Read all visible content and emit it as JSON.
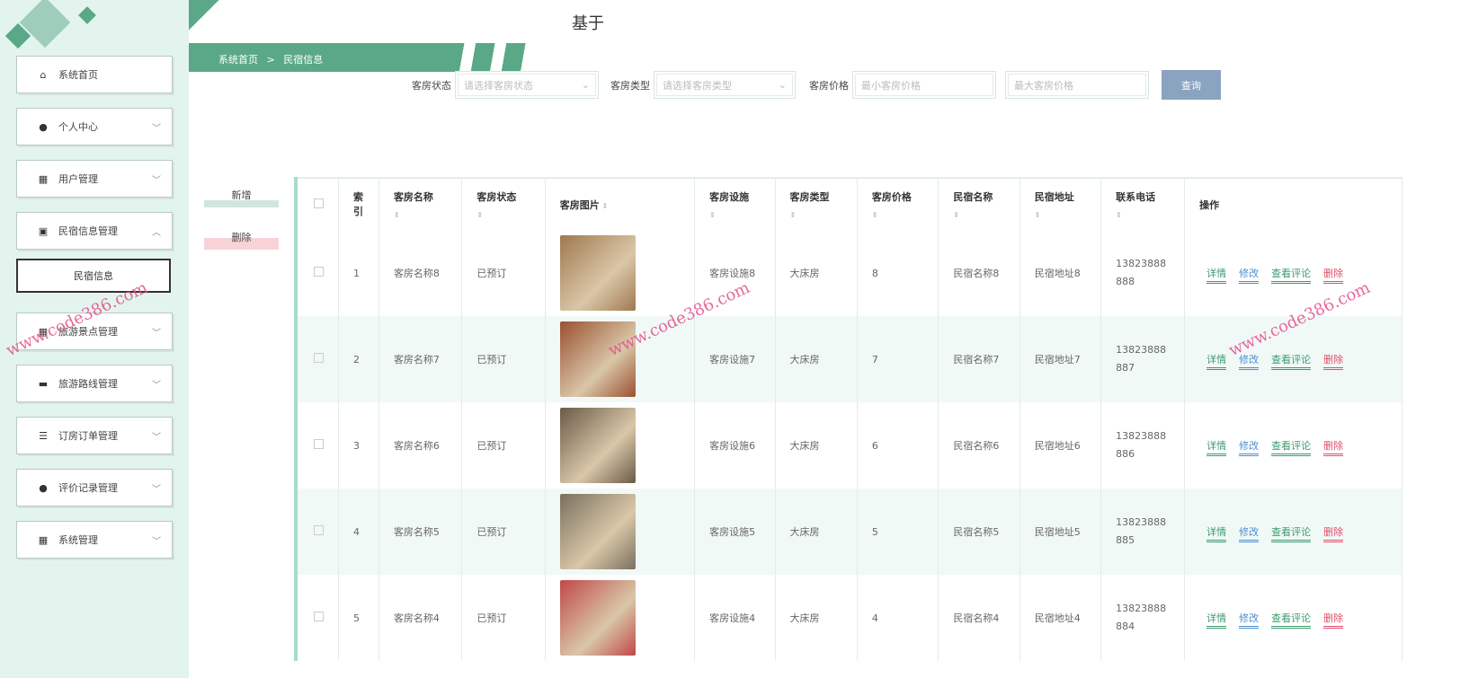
{
  "header": {
    "title": "基于",
    "breadcrumb": [
      "系统首页",
      ">",
      "民宿信息"
    ]
  },
  "sidebar": {
    "items": [
      {
        "label": "系统首页",
        "icon": "home-icon",
        "glyph": "⌂"
      },
      {
        "label": "个人中心",
        "icon": "user-icon",
        "glyph": "●"
      },
      {
        "label": "用户管理",
        "icon": "grid-icon",
        "glyph": "▦"
      },
      {
        "label": "民宿信息管理",
        "icon": "clipboard-icon",
        "glyph": "▣"
      },
      {
        "label": "旅游景点管理",
        "icon": "grid-icon",
        "glyph": "▦"
      },
      {
        "label": "旅游路线管理",
        "icon": "briefcase-icon",
        "glyph": "▬"
      },
      {
        "label": "订房订单管理",
        "icon": "list-icon",
        "glyph": "☰"
      },
      {
        "label": "评价记录管理",
        "icon": "user-icon",
        "glyph": "●"
      },
      {
        "label": "系统管理",
        "icon": "grid-icon",
        "glyph": "▦"
      }
    ],
    "submenu": "民宿信息"
  },
  "search": {
    "status_label": "客房状态",
    "status_placeholder": "请选择客房状态",
    "type_label": "客房类型",
    "type_placeholder": "请选择客房类型",
    "price_label": "客房价格",
    "min_placeholder": "最小客房价格",
    "max_placeholder": "最大客房价格",
    "query": "查询"
  },
  "actions": {
    "add": "新增",
    "delete": "删除"
  },
  "table": {
    "headers": [
      "索引",
      "客房名称",
      "客房状态",
      "客房图片",
      "客房设施",
      "客房类型",
      "客房价格",
      "民宿名称",
      "民宿地址",
      "联系电话",
      "操作"
    ],
    "ops": [
      "详情",
      "修改",
      "查看评论",
      "删除"
    ],
    "rows": [
      {
        "index": "1",
        "name": "客房名称8",
        "status": "已预订",
        "facility": "客房设施8",
        "type": "大床房",
        "price": "8",
        "mname": "民宿名称8",
        "addr": "民宿地址8",
        "phone": "13823888888",
        "img": "#a07850"
      },
      {
        "index": "2",
        "name": "客房名称7",
        "status": "已预订",
        "facility": "客房设施7",
        "type": "大床房",
        "price": "7",
        "mname": "民宿名称7",
        "addr": "民宿地址7",
        "phone": "13823888887",
        "img": "#9a5030"
      },
      {
        "index": "3",
        "name": "客房名称6",
        "status": "已预订",
        "facility": "客房设施6",
        "type": "大床房",
        "price": "6",
        "mname": "民宿名称6",
        "addr": "民宿地址6",
        "phone": "13823888886",
        "img": "#6a5a48"
      },
      {
        "index": "4",
        "name": "客房名称5",
        "status": "已预订",
        "facility": "客房设施5",
        "type": "大床房",
        "price": "5",
        "mname": "民宿名称5",
        "addr": "民宿地址5",
        "phone": "13823888885",
        "img": "#7a7060"
      },
      {
        "index": "5",
        "name": "客房名称4",
        "status": "已预订",
        "facility": "客房设施4",
        "type": "大床房",
        "price": "4",
        "mname": "民宿名称4",
        "addr": "民宿地址4",
        "phone": "13823888884",
        "img": "#c04848"
      }
    ]
  },
  "watermark": "www.code386.com",
  "colors": {
    "accent": "#5aa887",
    "detail": "#3d9a6e",
    "edit": "#4a8fd0",
    "comment": "#3d9a6e",
    "delete": "#e0506a"
  }
}
